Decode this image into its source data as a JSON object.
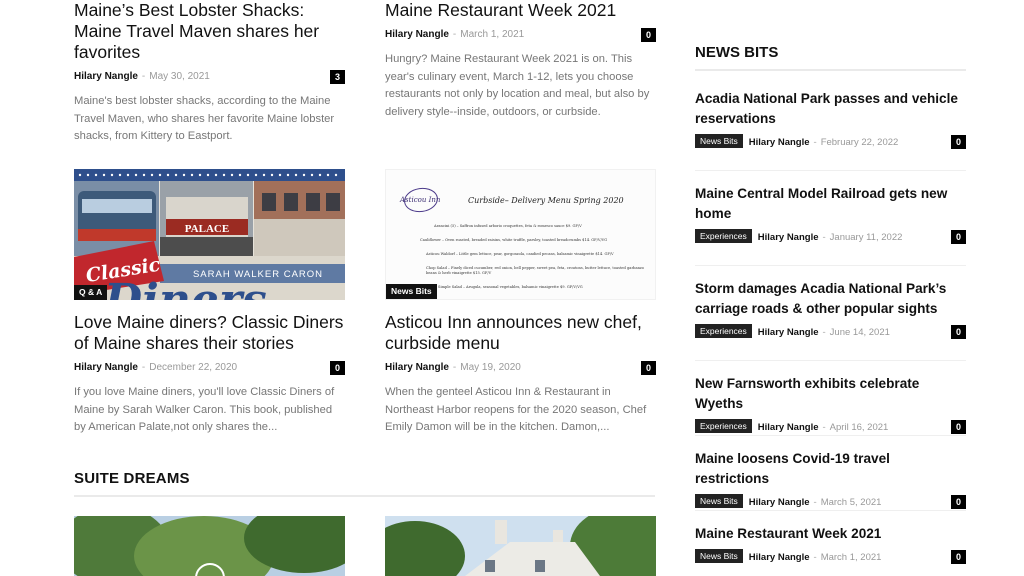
{
  "articles": [
    {
      "title": "Maine’s Best Lobster Shacks: Maine Travel Maven shares her favorites",
      "author": "Hilary Nangle",
      "sep": "-",
      "date": "May 30, 2021",
      "comments": "3",
      "excerpt": "Maine's best lobster shacks, according to the Maine Travel Maven, who shares her favorite Maine lobster shacks, from Kittery to Eastport."
    },
    {
      "title": "Maine Restaurant Week 2021",
      "author": "Hilary Nangle",
      "sep": "-",
      "date": "March 1, 2021",
      "comments": "0",
      "excerpt": "Hungry? Maine Restaurant Week 2021 is on. This year's culinary event, March 1-12, lets you choose restaurants not only by location and meal, but also by delivery style--inside, outdoors, or curbside."
    },
    {
      "title": "Love Maine diners? Classic Diners of Maine shares their stories",
      "author": "Hilary Nangle",
      "sep": "-",
      "date": "December 22, 2020",
      "comments": "0",
      "tag": "Q & A",
      "excerpt": "If you love Maine diners, you'll love Classic Diners of Maine by Sarah Walker Caron. This book, published by American Palate,not only shares the..."
    },
    {
      "title": "Asticou Inn announces new chef, curbside menu",
      "author": "Hilary Nangle",
      "sep": "-",
      "date": "May 19, 2020",
      "comments": "0",
      "tag": "News Bits",
      "excerpt": "When the genteel Asticou Inn & Restaurant in Northeast Harbor reopens for the 2020 season, Chef Emily Damon will be in the kitchen. Damon,..."
    }
  ],
  "diner_image": {
    "sign": "PALACE",
    "word": "Classic",
    "author": "SARAH WALKER CARON",
    "big": "Diners"
  },
  "menu_image": {
    "logo": "Asticou Inn",
    "heading": "Curbside– Delivery Menu Spring 2020",
    "lines": [
      "Arancini (5) – Saffron infused arborio croquettes, feta & romesco sauce   $9. GF/V",
      "Cauliflower – Oven roasted, breaded raisins, white truffle, parsley, toasted breadcrumbs  $14. GF/V/VG",
      "Asticou Waldorf – Little gem lettuce, pear, gorgonzola, candied pecans, balsamic vinaigrette  $14. GF/V",
      "Chop Salad – Finely diced cucumber, red onion, bell pepper, sweet pea, feta, croutons, butter lettuce, toasted garbanzo beans & herb vinaigrette  $15. GF/V",
      "Simple Salad – Arugula, seasonal vegetables, balsamic vinaigrette  $9. GF/V/VG"
    ]
  },
  "section": {
    "title": "SUITE DREAMS"
  },
  "sidebar": {
    "title": "NEWS BITS",
    "items": [
      {
        "title": "Acadia National Park passes and vehicle reservations",
        "category": "News Bits",
        "author": "Hilary Nangle",
        "sep": "-",
        "date": "February 22, 2022",
        "comments": "0"
      },
      {
        "title": "Maine Central Model Railroad gets new home",
        "category": "Experiences",
        "author": "Hilary Nangle",
        "sep": "-",
        "date": "January 11, 2022",
        "comments": "0"
      },
      {
        "title": "Storm damages Acadia National Park’s carriage roads & other popular sights",
        "category": "Experiences",
        "author": "Hilary Nangle",
        "sep": "-",
        "date": "June 14, 2021",
        "comments": "0"
      },
      {
        "title": "New Farnsworth exhibits celebrate Wyeths",
        "category": "Experiences",
        "author": "Hilary Nangle",
        "sep": "-",
        "date": "April 16, 2021",
        "comments": "0"
      },
      {
        "title": "Maine loosens Covid-19 travel restrictions",
        "category": "News Bits",
        "author": "Hilary Nangle",
        "sep": "-",
        "date": "March 5, 2021",
        "comments": "0"
      },
      {
        "title": "Maine Restaurant Week 2021",
        "category": "News Bits",
        "author": "Hilary Nangle",
        "sep": "-",
        "date": "March 1, 2021",
        "comments": "0"
      }
    ]
  }
}
